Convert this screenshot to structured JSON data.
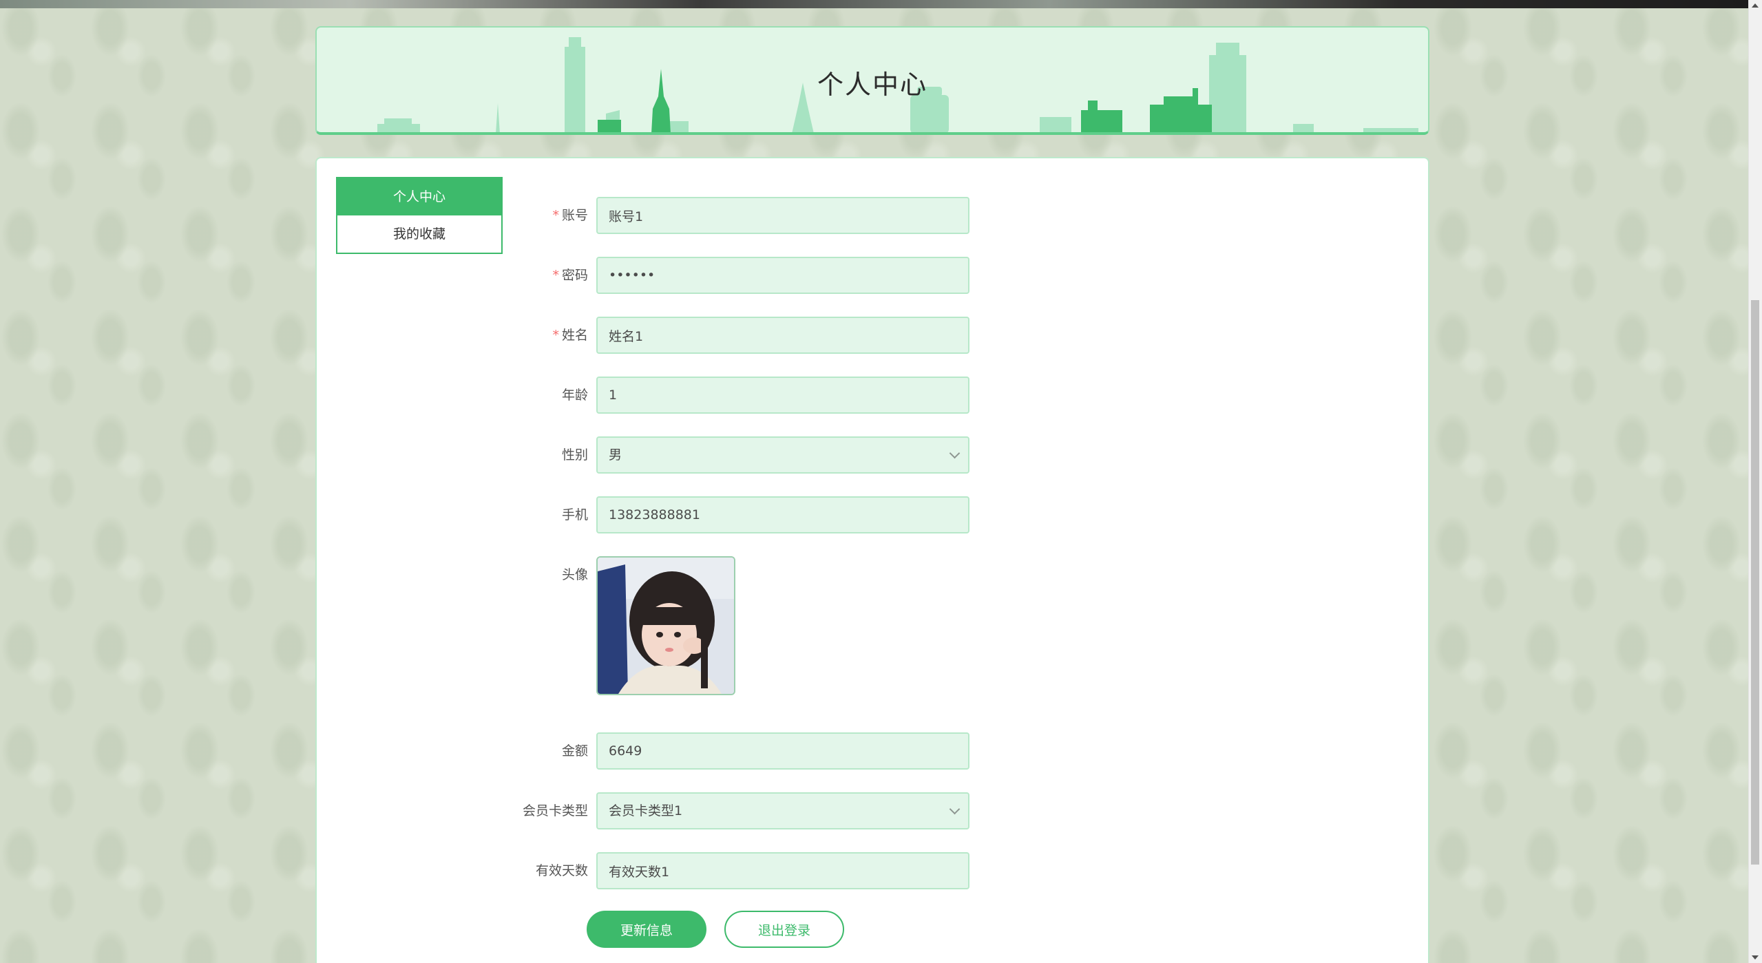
{
  "header": {
    "title": "个人中心"
  },
  "sidebar": {
    "items": [
      {
        "label": "个人中心",
        "active": true
      },
      {
        "label": "我的收藏",
        "active": false
      }
    ]
  },
  "form": {
    "account": {
      "label": "账号",
      "value": "账号1",
      "required": true
    },
    "password": {
      "label": "密码",
      "value": "••••••",
      "required": true
    },
    "name": {
      "label": "姓名",
      "value": "姓名1",
      "required": true
    },
    "age": {
      "label": "年龄",
      "value": "1"
    },
    "gender": {
      "label": "性别",
      "value": "男"
    },
    "phone": {
      "label": "手机",
      "value": "13823888881"
    },
    "avatar": {
      "label": "头像"
    },
    "balance": {
      "label": "金额",
      "value": "6649"
    },
    "card_type": {
      "label": "会员卡类型",
      "value": "会员卡类型1"
    },
    "valid_days": {
      "label": "有效天数",
      "value": "有效天数1"
    }
  },
  "buttons": {
    "update": "更新信息",
    "logout": "退出登录"
  },
  "theme": {
    "accent": "#3dba6b",
    "field_bg": "#e3f6ea",
    "page_bg": "#d3dcca",
    "required_mark": "#f56c6c"
  }
}
